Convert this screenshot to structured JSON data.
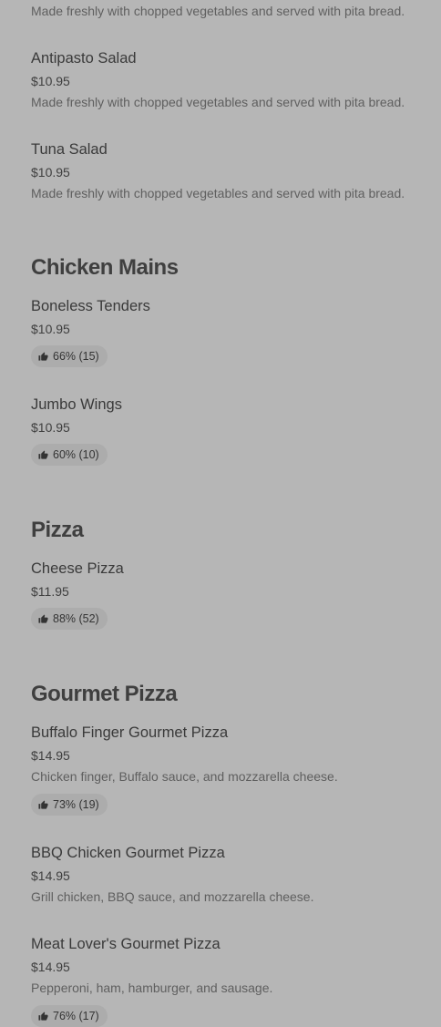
{
  "menu": {
    "top_partial_description": "Made freshly with chopped vegetables and served with pita bread.",
    "salads": [
      {
        "name": "Antipasto Salad",
        "price": "$10.95",
        "description": "Made freshly with chopped vegetables and served with pita bread."
      },
      {
        "name": "Tuna Salad",
        "price": "$10.95",
        "description": "Made freshly with chopped vegetables and served with pita bread."
      }
    ],
    "chicken_mains": {
      "title": "Chicken Mains",
      "items": [
        {
          "name": "Boneless Tenders",
          "price": "$10.95",
          "rating": "66% (15)"
        },
        {
          "name": "Jumbo Wings",
          "price": "$10.95",
          "rating": "60% (10)"
        }
      ]
    },
    "pizza": {
      "title": "Pizza",
      "items": [
        {
          "name": "Cheese Pizza",
          "price": "$11.95",
          "rating": "88% (52)"
        }
      ]
    },
    "gourmet_pizza": {
      "title": "Gourmet Pizza",
      "items": [
        {
          "name": "Buffalo Finger Gourmet Pizza",
          "price": "$14.95",
          "description": "Chicken finger, Buffalo sauce, and mozzarella cheese.",
          "rating": "73% (19)"
        },
        {
          "name": "BBQ Chicken Gourmet Pizza",
          "price": "$14.95",
          "description": "Grill chicken, BBQ sauce, and mozzarella cheese."
        },
        {
          "name": "Meat Lover's Gourmet Pizza",
          "price": "$14.95",
          "description": "Pepperoni, ham, hamburger, and sausage.",
          "rating": "76% (17)"
        }
      ]
    }
  },
  "icons": {
    "rating": "thumbs-up-icon"
  },
  "colors": {
    "background": "#b6b6b6",
    "badge_background": "#acacac",
    "text": "#3a3a3a",
    "muted_text": "#5f5f5f"
  }
}
